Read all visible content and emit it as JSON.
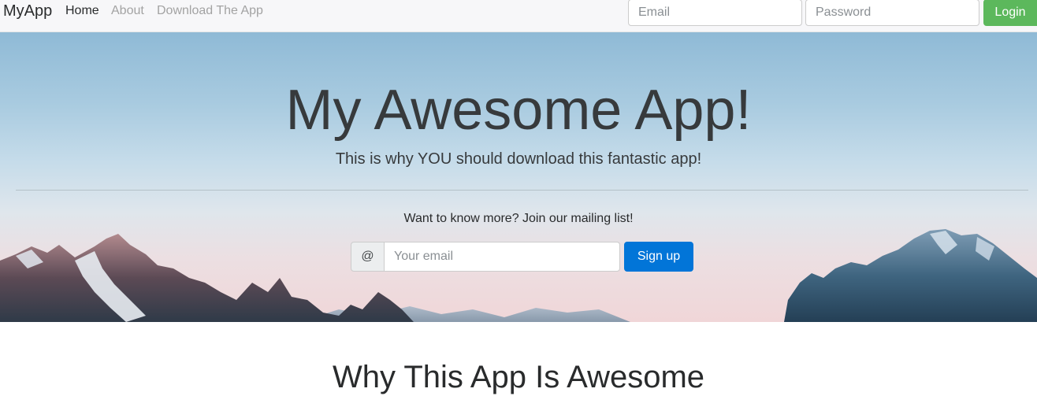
{
  "navbar": {
    "brand": "MyApp",
    "links": [
      {
        "label": "Home"
      },
      {
        "label": "About"
      },
      {
        "label": "Download The App"
      }
    ],
    "email_placeholder": "Email",
    "password_placeholder": "Password",
    "login_label": "Login",
    "login_color": "#5cb85c"
  },
  "hero": {
    "title": "My Awesome App!",
    "subtitle": "This is why YOU should download this fantastic app!",
    "mailing_prompt": "Want to know more? Join our mailing list!",
    "addon": "@",
    "email_placeholder": "Your email",
    "signup_label": "Sign up",
    "signup_color": "#0275d8"
  },
  "section": {
    "title": "Why This App Is Awesome"
  }
}
